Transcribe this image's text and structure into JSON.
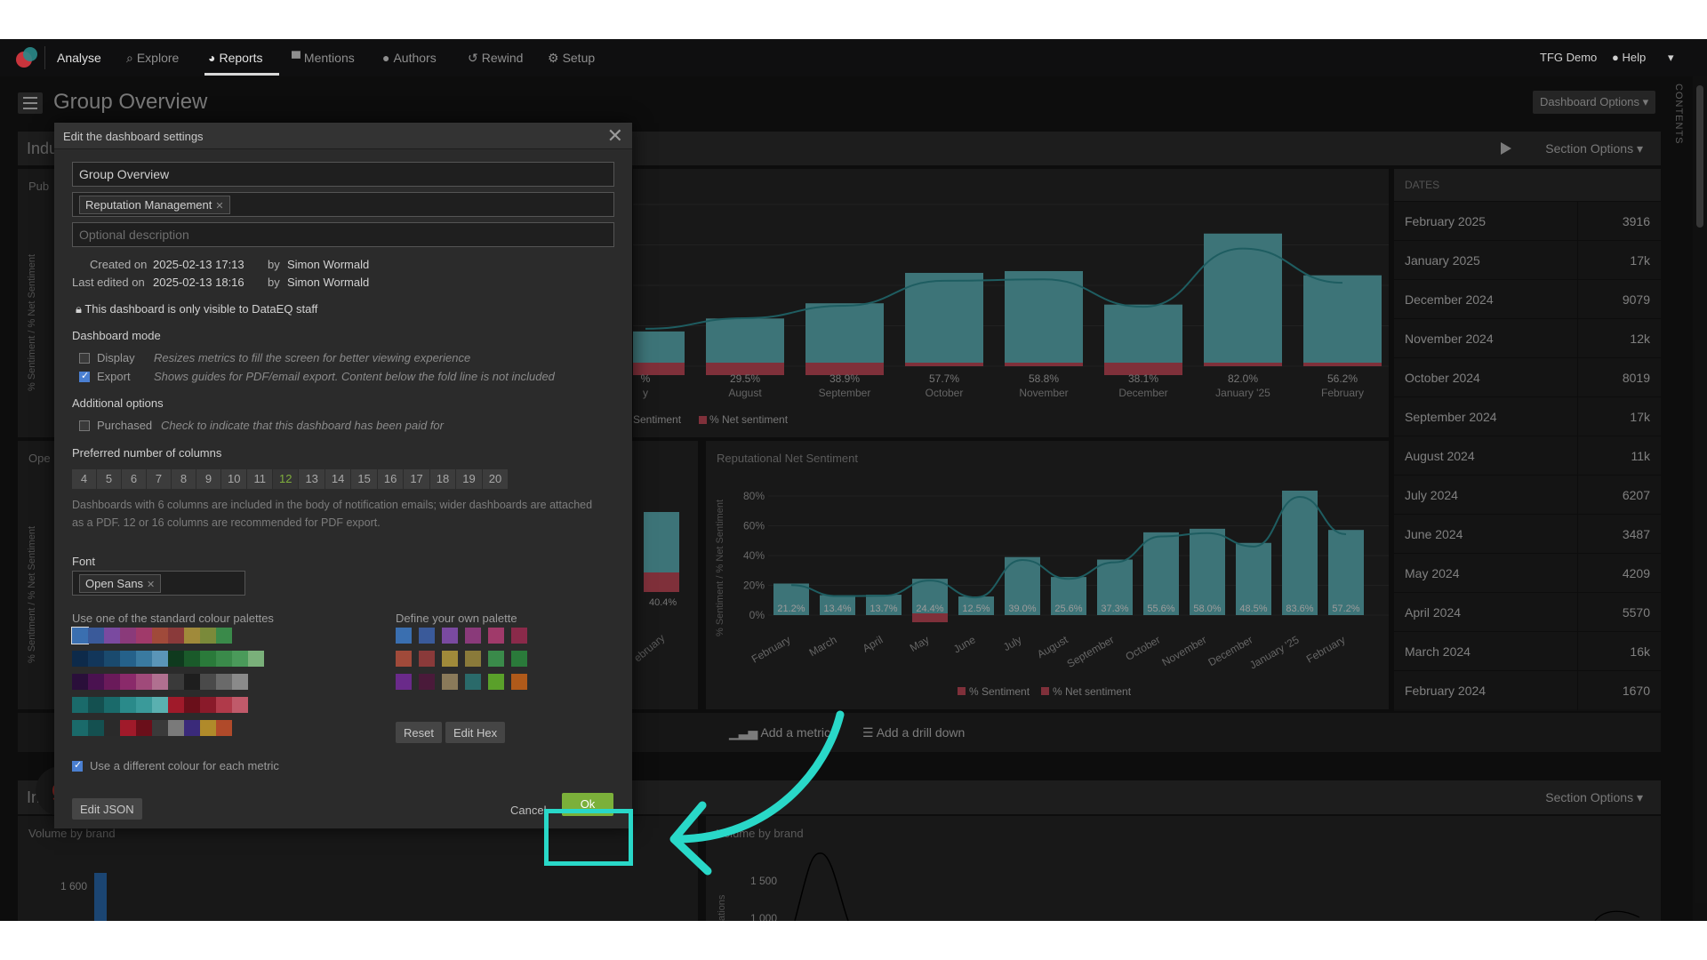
{
  "nav": {
    "brand": "Analyse",
    "items": [
      {
        "label": "Explore",
        "icon": "search-icon",
        "glyph": "🔍"
      },
      {
        "label": "Reports",
        "icon": "pie-chart-icon",
        "glyph": "◕"
      },
      {
        "label": "Mentions",
        "icon": "comment-icon",
        "glyph": "▀"
      },
      {
        "label": "Authors",
        "icon": "person-icon",
        "glyph": "👤"
      },
      {
        "label": "Rewind",
        "icon": "history-icon",
        "glyph": "↺"
      },
      {
        "label": "Setup",
        "icon": "gear-icon",
        "glyph": "⚙"
      }
    ],
    "account": "TFG Demo",
    "help": "Help"
  },
  "page": {
    "title": "Group Overview",
    "dashboard_options": "Dashboard Options ▾",
    "contents": "CONTENTS"
  },
  "sections": [
    {
      "title": "Indu",
      "options": "Section Options ▾"
    },
    {
      "title": "Indu",
      "options": "Section Options ▾"
    }
  ],
  "panels": {
    "left_top_title": "Pub",
    "left_mid_title": "Ope",
    "left_axis": "% Sentiment / % Net Sentiment",
    "net_title": "Reputational Net Sentiment",
    "net_axis": "% Sentiment / % Net Sentiment",
    "vol_left_title": "Volume by brand",
    "vol_right_title": "Volume by brand",
    "vol_left_tick": "1 600",
    "vol_right_ticks": [
      "1 500",
      "1 000"
    ],
    "vol_right_axis": "ations",
    "left_mid_partial_label": "40.4%",
    "left_mid_partial_month": "ebruary"
  },
  "chart_top": {
    "type": "bar",
    "categories": [
      "y",
      "August",
      "September",
      "October",
      "November",
      "December",
      "January '25",
      "February"
    ],
    "values": [
      21.5,
      29.5,
      38.9,
      57.7,
      58.8,
      38.1,
      82.0,
      56.2
    ],
    "labels": [
      "%",
      "29.5%",
      "38.9%",
      "57.7%",
      "58.8%",
      "38.1%",
      "82.0%",
      "56.2%"
    ],
    "legend": [
      "Sentiment",
      "% Net sentiment"
    ],
    "ylim": [
      0,
      100
    ],
    "bar_color": "#5fb3b8",
    "neg_color": "#c44a5a"
  },
  "chart_net": {
    "type": "bar",
    "categories": [
      "February",
      "March",
      "April",
      "May",
      "June",
      "July",
      "August",
      "September",
      "October",
      "November",
      "December",
      "January '25",
      "February"
    ],
    "values": [
      21.2,
      13.4,
      13.7,
      24.4,
      12.5,
      39.0,
      25.6,
      37.3,
      55.6,
      58.0,
      48.5,
      83.6,
      57.2
    ],
    "labels": [
      "21.2%",
      "13.4%",
      "13.7%",
      "24.4%",
      "12.5%",
      "39.0%",
      "25.6%",
      "37.3%",
      "55.6%",
      "58.0%",
      "48.5%",
      "83.6%",
      "57.2%"
    ],
    "yticks": [
      "80%",
      "60%",
      "40%",
      "20%",
      "0%"
    ],
    "ylim": [
      0,
      80
    ],
    "legend": [
      "% Sentiment",
      "% Net sentiment"
    ]
  },
  "dates": {
    "header": "DATES",
    "rows": [
      {
        "label": "February 2025",
        "value": "3916"
      },
      {
        "label": "January 2025",
        "value": "17k"
      },
      {
        "label": "December 2024",
        "value": "9079"
      },
      {
        "label": "November 2024",
        "value": "12k"
      },
      {
        "label": "October 2024",
        "value": "8019"
      },
      {
        "label": "September 2024",
        "value": "17k"
      },
      {
        "label": "August 2024",
        "value": "11k"
      },
      {
        "label": "July 2024",
        "value": "6207"
      },
      {
        "label": "June 2024",
        "value": "3487"
      },
      {
        "label": "May 2024",
        "value": "4209"
      },
      {
        "label": "April 2024",
        "value": "5570"
      },
      {
        "label": "March 2024",
        "value": "16k"
      },
      {
        "label": "February 2024",
        "value": "1670"
      }
    ]
  },
  "add_bar": {
    "metric": "Add a metric",
    "drill": "Add a drill down"
  },
  "modal": {
    "title": "Edit the dashboard settings",
    "name_value": "Group Overview",
    "tag": "Reputation Management",
    "description_placeholder": "Optional description",
    "created_label": "Created on",
    "created_value": "2025-02-13 17:13",
    "edited_label": "Last edited on",
    "edited_value": "2025-02-13 18:16",
    "by": "by",
    "created_by": "Simon Wormald",
    "edited_by": "Simon Wormald",
    "visibility": "This dashboard is only visible to DataEQ staff",
    "mode_heading": "Dashboard mode",
    "display_label": "Display",
    "display_desc": "Resizes metrics to fill the screen for better viewing experience",
    "export_label": "Export",
    "export_desc": "Shows guides for PDF/email export. Content below the fold line is not included",
    "additional_heading": "Additional options",
    "purchased_label": "Purchased",
    "purchased_desc": "Check to indicate that this dashboard has been paid for",
    "columns_heading": "Preferred number of columns",
    "columns": [
      "4",
      "5",
      "6",
      "7",
      "8",
      "9",
      "10",
      "11",
      "12",
      "13",
      "14",
      "15",
      "16",
      "17",
      "18",
      "19",
      "20"
    ],
    "selected_column": "12",
    "columns_note": "Dashboards with 6 columns are included in the body of notification emails; wider dashboards are attached as a PDF. 12 or 16 columns are recommended for PDF export.",
    "font_heading": "Font",
    "font_value": "Open Sans",
    "standard_palettes_heading": "Use one of the standard colour palettes",
    "own_palette_heading": "Define your own palette",
    "reset": "Reset",
    "edit_hex": "Edit Hex",
    "different_colour": "Use a different colour for each metric",
    "edit_json": "Edit JSON",
    "cancel": "Cancel",
    "ok": "Ok",
    "standard_palettes": [
      [
        "#3a6fb0",
        "#3a5a9a",
        "#7a4aa0",
        "#8a3a7a",
        "#a03a6a",
        "#a04a3a",
        "#8a3a3a",
        "#a08a3a",
        "#7a8a3a",
        "#3a8a4a"
      ],
      [
        "#0d2a4a",
        "#12365a",
        "#1a4a6e",
        "#25618a",
        "#3a7aa0",
        "#5a95b8",
        "#0f3a1e",
        "#1a5a2a",
        "#2a7a3a",
        "#3a8a4a",
        "#4a9a5a",
        "#7ab07a"
      ],
      [
        "#2a0f3a",
        "#4a1250",
        "#6a1a5a",
        "#8a2a6a",
        "#a04a7a",
        "#b07090",
        "#3a3a3a",
        "#1e1e1e",
        "#4a4a4a",
        "#6a6a6a",
        "#8a8a8a"
      ],
      [
        "#1a6a6a",
        "#145050",
        "#1a6a6a",
        "#2a8a8a",
        "#3a9a9a",
        "#5ab0b0",
        "#a01a2a",
        "#6a0f1a",
        "#8a1a2a",
        "#b03a4a",
        "#c05a6a"
      ],
      [
        "#1a6a6a",
        "#145050",
        "#2a2a2a",
        "#a01a2a",
        "#6a0f1a",
        "#3a3a3a",
        "#7a7a7a",
        "#3a2a7a",
        "#b08a2a",
        "#b04a2a"
      ]
    ],
    "own_palette": [
      [
        "#3a6fb0",
        "#3a5a9a",
        "#7a4aa0",
        "#8a3a7a",
        "#a03a6a",
        "#8a2a4a"
      ],
      [
        "#a04a3a",
        "#8a3a3a",
        "#a08a3a",
        "#8a7a3a",
        "#3a8a4a",
        "#2a7a3a"
      ],
      [
        "#6a2a8a",
        "#4a1a3a",
        "#8a7a5a",
        "#2a6a6a",
        "#5aa02a",
        "#b05a1a"
      ]
    ]
  }
}
